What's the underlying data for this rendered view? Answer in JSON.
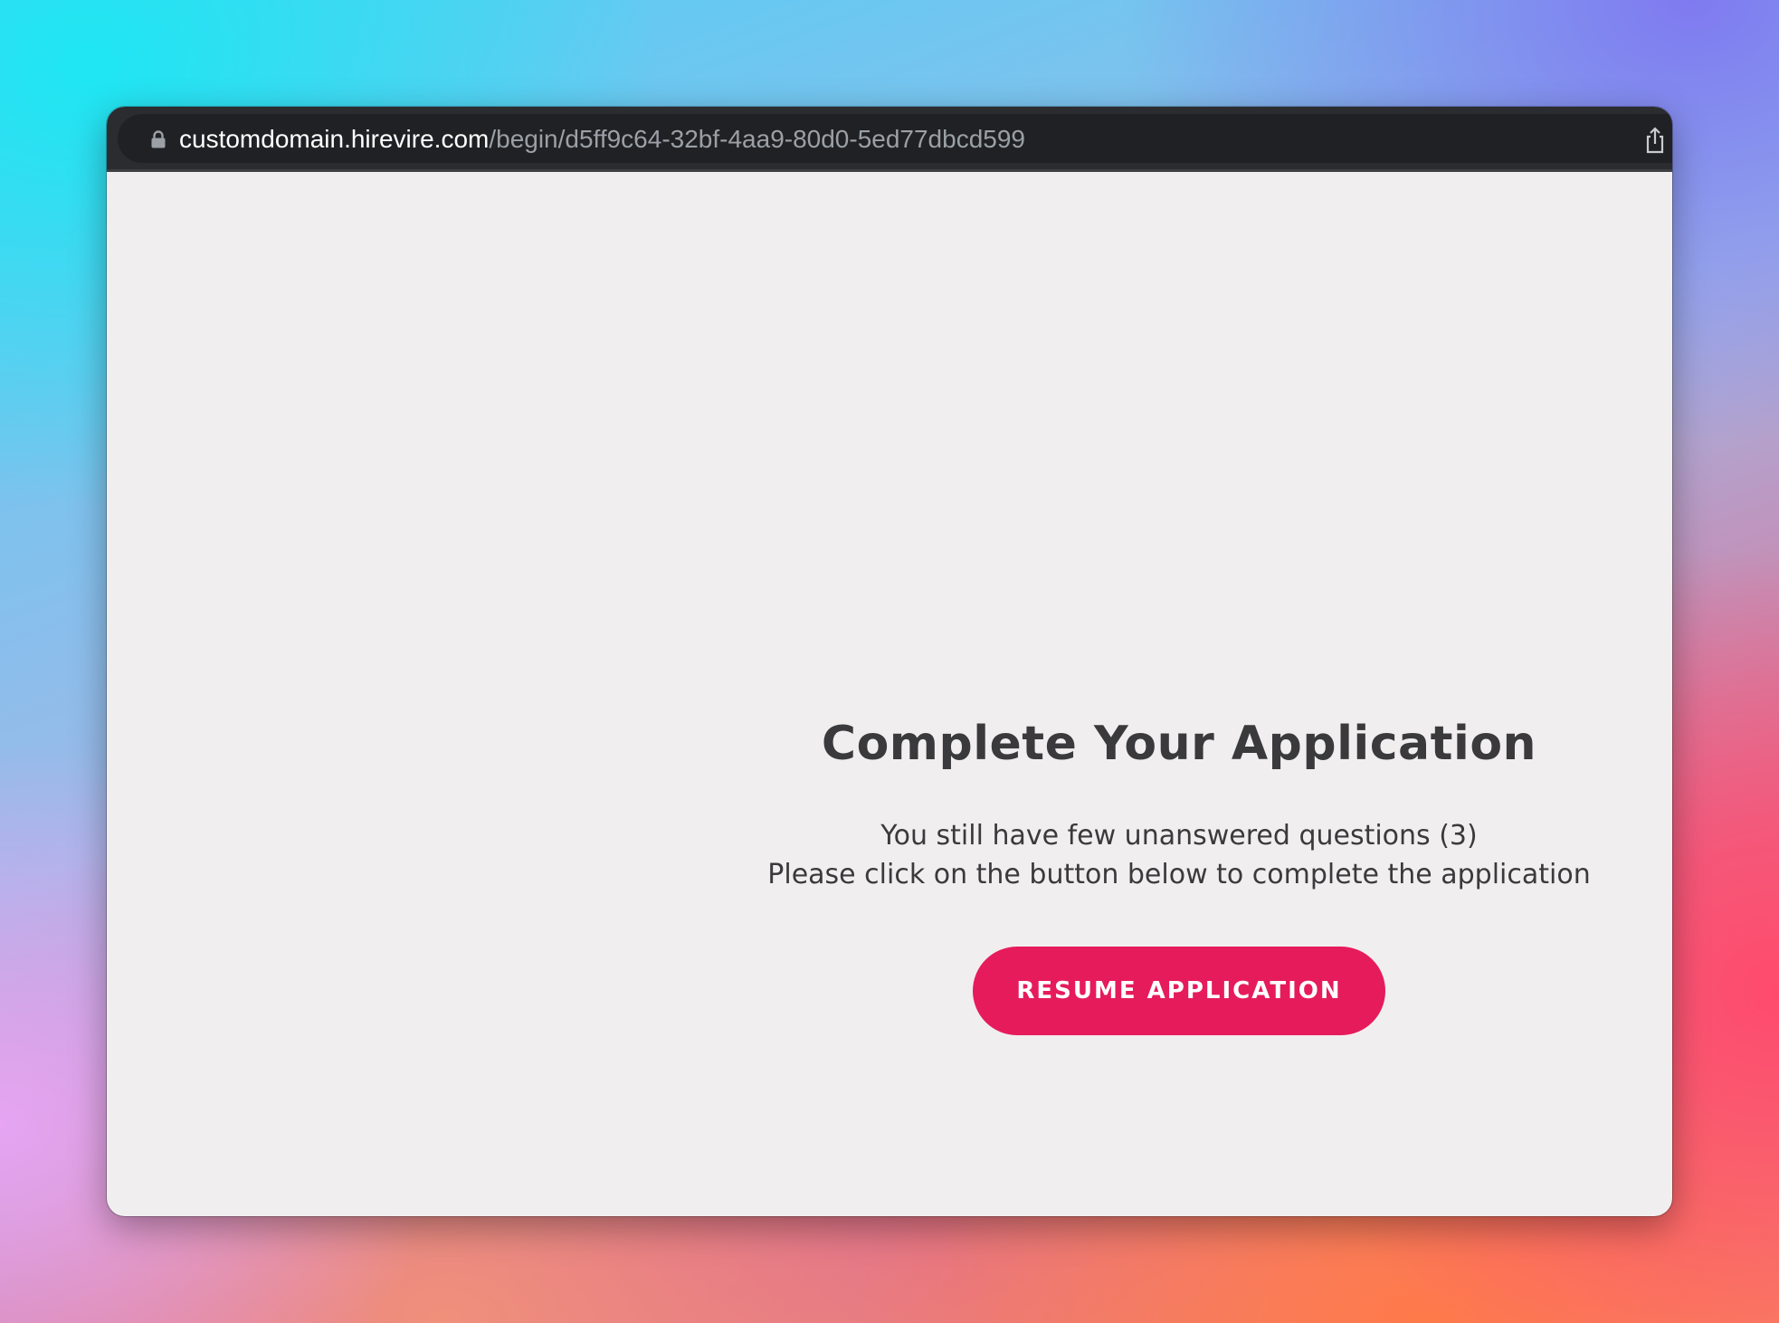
{
  "browser": {
    "url_host": "customdomain.hirevire.com",
    "url_path": "/begin/d5ff9c64-32bf-4aa9-80d0-5ed77dbcd599",
    "icons": {
      "lock": "lock-icon",
      "share": "share-icon"
    }
  },
  "page": {
    "title": "Complete Your Application",
    "message_line1": "You still have few unanswered questions  (3)",
    "message_line2": "Please click on the button below to complete the application",
    "resume_button_label": "RESUME APPLICATION"
  },
  "colors": {
    "accent": "#e61b5c",
    "page_background": "#f1eeef",
    "text": "#3a3a3c",
    "address_bar": "#202124"
  }
}
